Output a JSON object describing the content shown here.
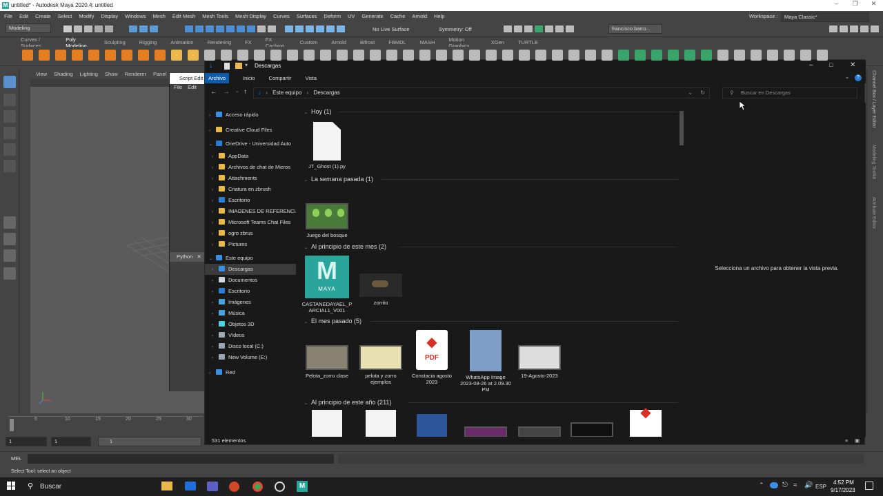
{
  "maya": {
    "title": "untitled* - Autodesk Maya 2020.4: untitled",
    "menus": [
      "File",
      "Edit",
      "Create",
      "Select",
      "Modify",
      "Display",
      "Windows",
      "Mesh",
      "Edit Mesh",
      "Mesh Tools",
      "Mesh Display",
      "Curves",
      "Surfaces",
      "Deform",
      "UV",
      "Generate",
      "Cache",
      "Arnold",
      "Help"
    ],
    "mode": "Modeling",
    "live_surface": "No Live Surface",
    "symmetry": "Symmetry: Off",
    "user": "francisco.barro...",
    "workspace_label": "Workspace :",
    "workspace": "Maya Classic*",
    "shelf_tabs": [
      "Curves / Surfaces",
      "Poly Modeling",
      "Sculpting",
      "Rigging",
      "Animation",
      "Rendering",
      "FX",
      "FX Caching",
      "Custom",
      "Arnold",
      "Bifrost",
      "FBMDL",
      "MASH",
      "Motion Graphics",
      "XGen",
      "TURTLE"
    ],
    "active_shelf": "Poly Modeling",
    "viewport_menu": [
      "View",
      "Shading",
      "Lighting",
      "Show",
      "Renderer",
      "Panel"
    ],
    "script_editor_label": "Script Edit",
    "script_editor_menu": [
      "File",
      "Edit"
    ],
    "python_tab": "Python",
    "timeline_ticks": [
      "5",
      "10",
      "15",
      "20",
      "25",
      "30"
    ],
    "range_start": "1",
    "range_current": "1",
    "range_field": "1",
    "cmd_lang": "MEL",
    "help_line": "Select Tool: select an object",
    "side_tabs": [
      "Channel Box / Layer Editor",
      "Modeling Toolkit",
      "Attribute Editor"
    ]
  },
  "explorer": {
    "title": "Descargas",
    "ribbon": [
      "Archivo",
      "Inicio",
      "Compartir",
      "Vista"
    ],
    "breadcrumb": [
      "Este equipo",
      "Descargas"
    ],
    "search_placeholder": "Buscar en Descargas",
    "nav": [
      {
        "label": "Acceso rápido",
        "indent": 0,
        "icon": "star",
        "color": "#3b8ee6"
      },
      {
        "label": "Creative Cloud Files",
        "indent": 0,
        "icon": "folder",
        "color": "#e8b84b"
      },
      {
        "label": "OneDrive - Universidad Auto",
        "indent": 0,
        "icon": "cloud",
        "color": "#2b7cd3"
      },
      {
        "label": "AppData",
        "indent": 1,
        "icon": "folder",
        "color": "#e8b84b"
      },
      {
        "label": "Archivos de chat de Micros",
        "indent": 1,
        "icon": "folder",
        "color": "#e8b84b"
      },
      {
        "label": "Attachments",
        "indent": 1,
        "icon": "folder",
        "color": "#e8b84b"
      },
      {
        "label": "Criatura en zbrush",
        "indent": 1,
        "icon": "folder",
        "color": "#e8b84b"
      },
      {
        "label": "Escritorio",
        "indent": 1,
        "icon": "folder",
        "color": "#2b7cd3"
      },
      {
        "label": "IMAGENES DE REFERENCIA",
        "indent": 1,
        "icon": "folder",
        "color": "#e8b84b"
      },
      {
        "label": "Microsoft Teams Chat Files",
        "indent": 1,
        "icon": "folder",
        "color": "#e8b84b"
      },
      {
        "label": "ogro zbrus",
        "indent": 1,
        "icon": "folder",
        "color": "#e8b84b"
      },
      {
        "label": "Pictures",
        "indent": 1,
        "icon": "folder",
        "color": "#e8b84b"
      },
      {
        "label": "Este equipo",
        "indent": 0,
        "icon": "pc",
        "color": "#3b8ee6"
      },
      {
        "label": "Descargas",
        "indent": 1,
        "icon": "download",
        "color": "#3b8ee6"
      },
      {
        "label": "Documentos",
        "indent": 1,
        "icon": "doc",
        "color": "#cfd6df"
      },
      {
        "label": "Escritorio",
        "indent": 1,
        "icon": "folder",
        "color": "#2b7cd3"
      },
      {
        "label": "Imágenes",
        "indent": 1,
        "icon": "image",
        "color": "#4aa3df"
      },
      {
        "label": "Música",
        "indent": 1,
        "icon": "music",
        "color": "#4aa3df"
      },
      {
        "label": "Objetos 3D",
        "indent": 1,
        "icon": "cube",
        "color": "#4ad0e0"
      },
      {
        "label": "Vídeos",
        "indent": 1,
        "icon": "video",
        "color": "#a0a8b0"
      },
      {
        "label": "Disco local (C:)",
        "indent": 1,
        "icon": "drive",
        "color": "#9aa4ae"
      },
      {
        "label": "New Volume (E:)",
        "indent": 1,
        "icon": "drive",
        "color": "#9aa4ae"
      },
      {
        "label": "Red",
        "indent": 0,
        "icon": "network",
        "color": "#3b8ee6"
      }
    ],
    "groups": [
      {
        "label": "Hoy (1)"
      },
      {
        "label": "La semana pasada (1)"
      },
      {
        "label": "Al principio de este mes (2)"
      },
      {
        "label": "El mes pasado (5)"
      },
      {
        "label": "Al principio de este año (211)"
      }
    ],
    "files": {
      "hoy": [
        {
          "name": "JT_Ghost (1).py"
        }
      ],
      "semana": [
        {
          "name": "Juego del bosque"
        }
      ],
      "mes": [
        {
          "name": "CASTANEDAYAEL_PARCIAL1_V001",
          "badge": "MAYA"
        },
        {
          "name": "zorrito"
        }
      ],
      "mes_pasado": [
        {
          "name": "Pelota_zorro clase"
        },
        {
          "name": "pelota y zorro ejemplos"
        },
        {
          "name": "Constacia agosto 2023",
          "badge": "PDF"
        },
        {
          "name": "WhatsApp Image 2023-08-26 at 2.09.30 PM"
        },
        {
          "name": "19-Agosto-2023"
        }
      ]
    },
    "preview_msg": "Selecciona un archivo para obtener la vista previa.",
    "status": "531 elementos"
  },
  "taskbar": {
    "search": "Buscar",
    "lang": "ESP",
    "time": "4:52 PM",
    "date": "9/17/2023"
  }
}
